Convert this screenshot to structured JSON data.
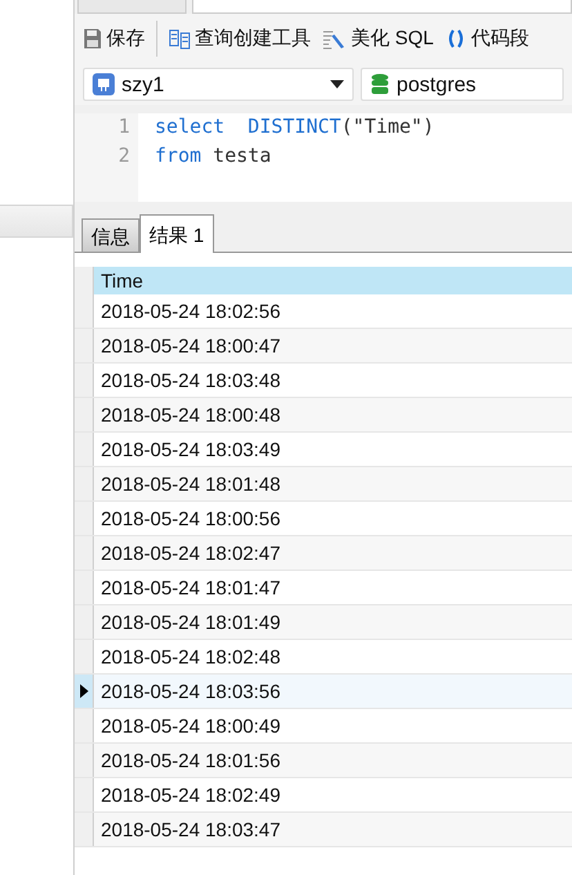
{
  "toolbar": [
    {
      "kind": "save",
      "label": "保存"
    },
    {
      "kind": "builder",
      "label": "查询创建工具"
    },
    {
      "kind": "beautify",
      "label": "美化 SQL"
    },
    {
      "kind": "snippet",
      "label": "代码段"
    }
  ],
  "connection": {
    "value": "szy1"
  },
  "database": {
    "value": "postgres"
  },
  "editor": {
    "lines": [
      {
        "number": "1",
        "tokens": [
          {
            "kind": "keyword",
            "text": "select  DISTINCT"
          },
          {
            "kind": "plain",
            "text": "(\"Time\")"
          }
        ]
      },
      {
        "number": "2",
        "tokens": [
          {
            "kind": "keyword",
            "text": "from"
          },
          {
            "kind": "plain",
            "text": " testa"
          }
        ]
      }
    ]
  },
  "result_tabs": [
    {
      "label": "信息",
      "selected": false
    },
    {
      "label": "结果 1",
      "selected": true
    }
  ],
  "grid": {
    "columns": [
      "Time"
    ],
    "rows": [
      {
        "cells": [
          "2018-05-24 18:02:56"
        ],
        "selected": false
      },
      {
        "cells": [
          "2018-05-24 18:00:47"
        ],
        "selected": false
      },
      {
        "cells": [
          "2018-05-24 18:03:48"
        ],
        "selected": false
      },
      {
        "cells": [
          "2018-05-24 18:00:48"
        ],
        "selected": false
      },
      {
        "cells": [
          "2018-05-24 18:03:49"
        ],
        "selected": false
      },
      {
        "cells": [
          "2018-05-24 18:01:48"
        ],
        "selected": false
      },
      {
        "cells": [
          "2018-05-24 18:00:56"
        ],
        "selected": false
      },
      {
        "cells": [
          "2018-05-24 18:02:47"
        ],
        "selected": false
      },
      {
        "cells": [
          "2018-05-24 18:01:47"
        ],
        "selected": false
      },
      {
        "cells": [
          "2018-05-24 18:01:49"
        ],
        "selected": false
      },
      {
        "cells": [
          "2018-05-24 18:02:48"
        ],
        "selected": false
      },
      {
        "cells": [
          "2018-05-24 18:03:56"
        ],
        "selected": true
      },
      {
        "cells": [
          "2018-05-24 18:00:49"
        ],
        "selected": false
      },
      {
        "cells": [
          "2018-05-24 18:01:56"
        ],
        "selected": false
      },
      {
        "cells": [
          "2018-05-24 18:02:49"
        ],
        "selected": false
      },
      {
        "cells": [
          "2018-05-24 18:03:47"
        ],
        "selected": false
      }
    ]
  }
}
